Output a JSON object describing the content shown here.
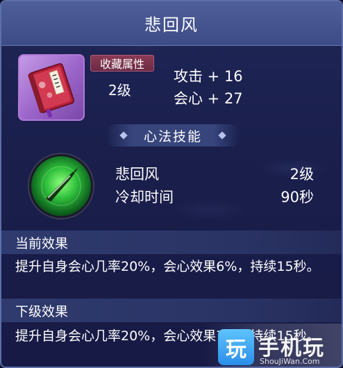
{
  "title": "悲回风",
  "item": {
    "icon": "red-tome-icon",
    "attr_tag": "收藏属性",
    "level": "2级",
    "stats": [
      "攻击 + 16",
      "会心 + 27"
    ]
  },
  "section_title": "心法技能",
  "skill": {
    "icon": "green-blade-skill-icon",
    "name": "悲回风",
    "level": "2级",
    "cooldown_label": "冷却时间",
    "cooldown_value": "90秒"
  },
  "current_effect": {
    "header": "当前效果",
    "text": "提升自身会心几率20%，会心效果6%，持续15秒。"
  },
  "next_effect": {
    "header": "下级效果",
    "text": "提升自身会心几率20%，会心效果7%，持续15秒。"
  },
  "watermark": {
    "logo_char": "玩",
    "brand": "手机玩",
    "url": "ShouJiWan.Com"
  },
  "colors": {
    "title_bar": "#3d4b86",
    "panel": "#1a1f4c",
    "attr_tag": "#6b2a42",
    "skill_glow": "#2fbf3c"
  }
}
